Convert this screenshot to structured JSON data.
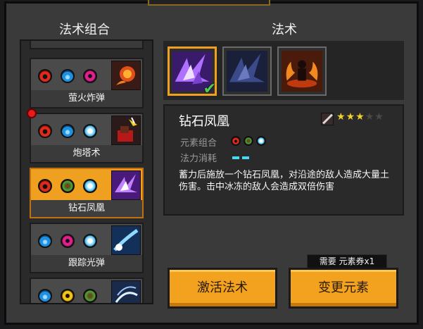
{
  "left_title": "法术组合",
  "right_title": "法术",
  "combos": [
    {
      "label": "萤火炸弹",
      "orbs": [
        "fire",
        "water",
        "poison"
      ],
      "thumb": "fireball-art"
    },
    {
      "label": "炮塔术",
      "orbs": [
        "fire",
        "water",
        "ice"
      ],
      "thumb": "turret-art",
      "badge": true
    },
    {
      "label": "钻石凤凰",
      "orbs": [
        "fire",
        "earth",
        "ice"
      ],
      "thumb": "phoenix-art",
      "selected": true
    },
    {
      "label": "跟踪光弹",
      "orbs": [
        "water",
        "poison",
        "ice"
      ],
      "thumb": "homing-orb-art"
    },
    {
      "label": "",
      "orbs": [
        "water",
        "bolt",
        "earth"
      ],
      "thumb": "wind-art"
    }
  ],
  "spell_slots": [
    {
      "name": "diamond-phoenix",
      "active": true,
      "checked": true
    },
    {
      "name": "frost-phoenix",
      "active": false
    },
    {
      "name": "flame-summon",
      "active": false
    }
  ],
  "detail": {
    "name": "钻石凤凰",
    "rating": 3,
    "rating_max": 5,
    "combo_label": "元素组合",
    "combo_orbs": [
      "fire",
      "earth",
      "ice"
    ],
    "cost_label": "法力消耗",
    "cost": 2,
    "description": "蓄力后施放一个钻石凤凰，对沿途的敌人造成大量土伤害。击中冰冻的敌人会造成双倍伤害"
  },
  "need_label": "需要 元素券x1",
  "buttons": {
    "activate": "激活法术",
    "change": "变更元素"
  },
  "colors": {
    "accent": "#f2a21e",
    "panel": "#3a3a3a",
    "selected": "#f0a020",
    "check": "#4ad04a",
    "star": "#f2d22a"
  }
}
